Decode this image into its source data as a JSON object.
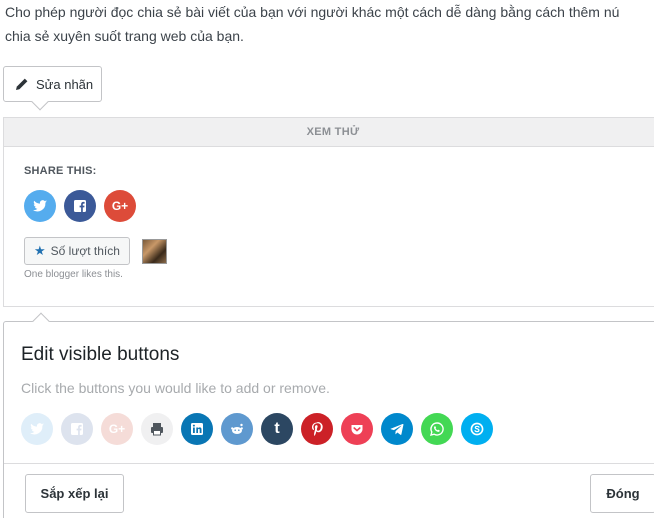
{
  "intro": {
    "line1": "Cho phép người đọc chia sẻ bài viết của bạn với người khác một cách dễ dàng bằng cách thêm nú",
    "line2": "chia sẻ xuyên suốt trang web của bạn."
  },
  "edit_label_button": "Sửa nhãn",
  "preview": {
    "header": "XEM THỬ",
    "share_title": "SHARE THIS:",
    "icons": [
      {
        "name": "twitter-icon",
        "color": "#55acee"
      },
      {
        "name": "facebook-icon",
        "color": "#3b5998"
      },
      {
        "name": "google-plus-icon",
        "color": "#dd4b39"
      }
    ],
    "like_button": "Số lượt thích",
    "likes_note": "One blogger likes this."
  },
  "panel": {
    "title": "Edit visible buttons",
    "subtitle": "Click the buttons you would like to add or remove.",
    "icons": [
      {
        "name": "twitter-icon",
        "color": "#dfeef9",
        "active": false
      },
      {
        "name": "facebook-icon",
        "color": "#dde3ee",
        "active": false
      },
      {
        "name": "google-plus-icon",
        "color": "#f5dcd8",
        "active": false
      },
      {
        "name": "print-icon",
        "color": "#f0f0f1",
        "active": false
      },
      {
        "name": "linkedin-icon",
        "color": "#0976b4",
        "active": true
      },
      {
        "name": "reddit-icon",
        "color": "#5f99cf",
        "active": true
      },
      {
        "name": "tumblr-icon",
        "color": "#2c4762",
        "active": true
      },
      {
        "name": "pinterest-icon",
        "color": "#cc2127",
        "active": true
      },
      {
        "name": "pocket-icon",
        "color": "#ee4056",
        "active": true
      },
      {
        "name": "telegram-icon",
        "color": "#0088cc",
        "active": true
      },
      {
        "name": "whatsapp-icon",
        "color": "#43d854",
        "active": true
      },
      {
        "name": "skype-icon",
        "color": "#00aff0",
        "active": true
      }
    ],
    "rearrange_button": "Sắp xếp lại",
    "close_button": "Đóng"
  }
}
